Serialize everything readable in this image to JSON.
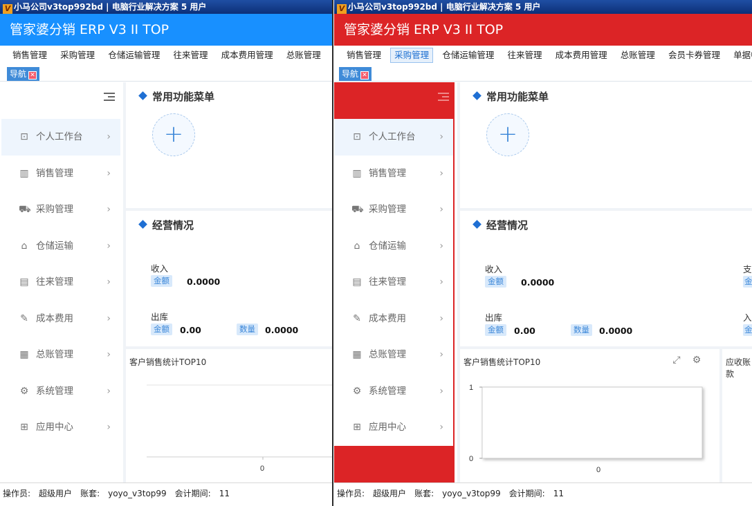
{
  "title_bar": {
    "text": "小马公司v3top992bd  | 电脑行业解决方案 5 用户",
    "icon": "app-logo-icon"
  },
  "app_title": "管家婆分销 ERP V3 II TOP",
  "menu": [
    "销售管理",
    "采购管理",
    "仓储运输管理",
    "往来管理",
    "成本费用管理",
    "总账管理",
    "会员卡券管理",
    "单据中心"
  ],
  "menu_left_truncated_last": "会员",
  "nav_tab": {
    "label": "导航",
    "close_icon": "close-icon"
  },
  "sidebar": {
    "collapse_icon": "menu-fold-icon",
    "items": [
      {
        "label": "个人工作台",
        "icon": "dashboard-icon"
      },
      {
        "label": "销售管理",
        "icon": "bar-chart-icon"
      },
      {
        "label": "采购管理",
        "icon": "cart-icon"
      },
      {
        "label": "仓储运输",
        "icon": "warehouse-icon"
      },
      {
        "label": "往来管理",
        "icon": "document-icon"
      },
      {
        "label": "成本费用",
        "icon": "cost-icon"
      },
      {
        "label": "总账管理",
        "icon": "ledger-icon"
      },
      {
        "label": "系统管理",
        "icon": "gear-icon"
      },
      {
        "label": "应用中心",
        "icon": "apps-icon"
      }
    ],
    "chevron": "›"
  },
  "quick_menu": {
    "title": "常用功能菜单",
    "add_symbol": "+"
  },
  "business": {
    "title": "经营情况",
    "income_label": "收入",
    "outbound_label": "出库",
    "amount_tag": "金额",
    "quantity_tag": "数量",
    "income_amount": "0.0000",
    "outbound_amount": "0.00",
    "outbound_quantity": "0.0000",
    "right_cut_labels": [
      "支",
      "入",
      "金",
      "金"
    ]
  },
  "chart_panel": {
    "title": "客户销售统计TOP10",
    "right_panel_title": "应收账款",
    "tools": [
      "expand-icon",
      "gear-icon"
    ]
  },
  "chart_data": [
    {
      "type": "bar",
      "title": "客户销售统计TOP10",
      "categories": [],
      "values": [],
      "x_ticks": [
        "0"
      ],
      "y_ticks": [],
      "note": "left window, empty chart"
    },
    {
      "type": "bar",
      "title": "客户销售统计TOP10",
      "categories": [],
      "values": [],
      "x_ticks": [
        "0"
      ],
      "y_ticks": [
        "0",
        "1"
      ],
      "ylim": [
        0,
        1
      ]
    }
  ],
  "status": {
    "operator_label": "操作员:",
    "operator": "超级用户",
    "account_label": "账套:",
    "account": "yoyo_v3top99",
    "period_label": "会计期间:",
    "period": "11"
  },
  "colors": {
    "blue_theme": "#1890ff",
    "red_theme": "#dc2426"
  }
}
